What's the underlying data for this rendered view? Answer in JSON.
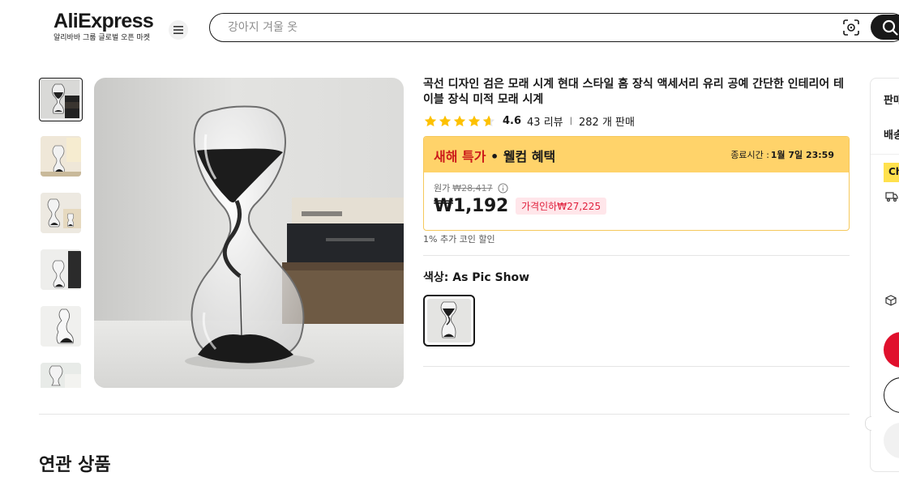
{
  "header": {
    "logo_text": "AliExpress",
    "logo_sub": "알리바바 그룹 글로벌 오픈 마켓",
    "search_placeholder": "강아지 겨울 옷"
  },
  "gallery": {
    "thumbnail_count": 6,
    "selected_index": 0
  },
  "product": {
    "title": "곡선 디자인 검은 모래 시계 현대 스타일 홈 장식 액세서리 유리 공예 간단한 인테리어 테이블 장식 미적 모래 시계",
    "rating": "4.6",
    "rating_stars": 4.6,
    "reviews": "43 리뷰",
    "sold": "282 개 판매"
  },
  "promo": {
    "name_highlight": "새해 특가",
    "name_rest": " • 웰컴 혜택",
    "end_label": "종료시간 :",
    "end_time": "1월 7일 23:59",
    "original_label": "원가",
    "original_price": "₩28,417",
    "price": "₩1,192",
    "discount_badge": "가격인하₩27,225",
    "coin_note": "1% 추가 코인 할인"
  },
  "variant": {
    "label": "색상: As Pic Show"
  },
  "related": {
    "title": "연관 상품"
  },
  "side_panel": {
    "sold_by_label": "판매",
    "shipping_label": "배송",
    "choice_badge": "Ch"
  },
  "colors": {
    "promo_bg": "#ffd36a",
    "promo_border": "#f5c85b",
    "highlight_red": "#cc1a1a",
    "discount_bg": "#ffe6ea",
    "discount_text": "#e0203d",
    "star": "#fdc100",
    "buy_button": "#e0102d",
    "choice_yellow": "#ffe14d"
  }
}
